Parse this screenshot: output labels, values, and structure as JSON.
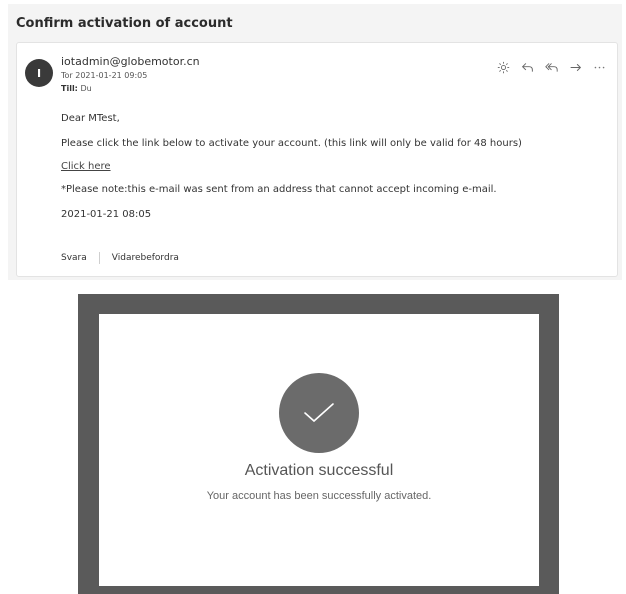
{
  "email": {
    "subject": "Confirm activation of account",
    "avatar_initial": "I",
    "sender": "iotadmin@globemotor.cn",
    "date": "Tor 2021-01-21 09:05",
    "to_label": "Till:",
    "to_value": "Du",
    "actions": [
      {
        "icon": "sun-icon"
      },
      {
        "icon": "reply-icon"
      },
      {
        "icon": "reply-all-icon"
      },
      {
        "icon": "forward-icon"
      },
      {
        "icon": "more-icon"
      }
    ],
    "greeting": "Dear MTest,",
    "instruction": "Please click the link below to activate your account. (this link will only be valid for 48 hours)",
    "link_text": "Click here",
    "note": "*Please note:this e-mail was sent from an address that cannot accept incoming e-mail.",
    "timestamp": "2021-01-21 08:05",
    "reply_label": "Svara",
    "forward_label": "Vidarebefordra"
  },
  "activation": {
    "title": "Activation successful",
    "message": "Your account has been successfully activated."
  },
  "colors": {
    "frame": "#5a5a5a",
    "check_circle": "#6b6b6b"
  }
}
